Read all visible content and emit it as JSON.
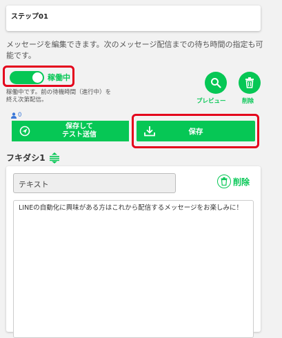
{
  "step": {
    "title": "ステップ01"
  },
  "description": "メッセージを編集できます。次のメッセージ配信までの待ち時間の指定も可能です。",
  "toggle": {
    "label": "稼働中",
    "on": true,
    "note": "稼働中です。前の待機時間（進行中）を終え次第配信。"
  },
  "actions": {
    "preview_label": "プレビュー",
    "delete_label": "削除",
    "count": "0",
    "test_send_label": "保存して\nテスト送信",
    "save_label": "保存"
  },
  "bubble": {
    "title": "フキダシ1",
    "type_value": "テキスト",
    "delete_label": "削除",
    "message": "LINEの自動化に興味がある方はこれから配信するメッセージをお楽しみに！"
  },
  "colors": {
    "accent": "#06c755",
    "highlight": "#e4001b",
    "count": "#3b78d8"
  },
  "icons": [
    "search-icon",
    "trash-icon",
    "send-icon",
    "download-icon",
    "user-icon",
    "drag-handle-icon"
  ]
}
